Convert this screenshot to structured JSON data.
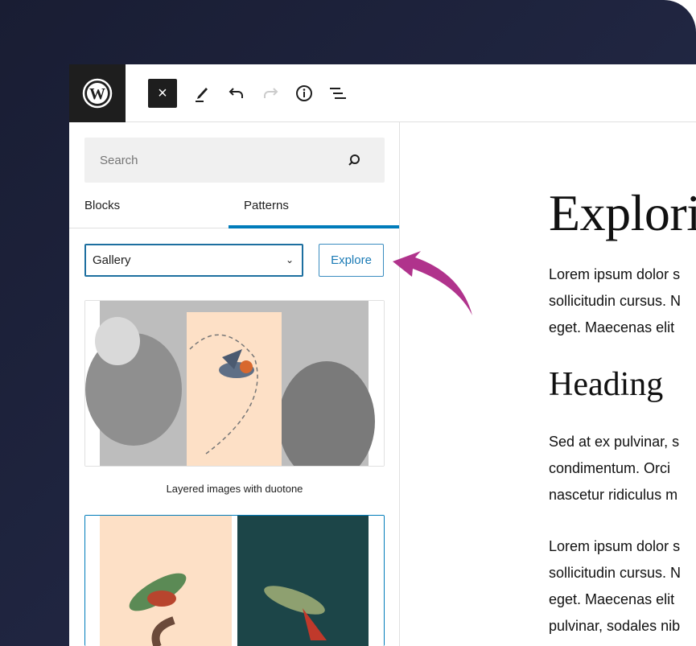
{
  "toolbar": {
    "close_label": "×"
  },
  "sidebar": {
    "search_placeholder": "Search",
    "tabs": [
      {
        "label": "Blocks"
      },
      {
        "label": "Patterns"
      }
    ],
    "category_select": "Gallery",
    "explore_label": "Explore",
    "patterns": [
      {
        "caption": "Layered images with duotone"
      },
      {
        "caption": ""
      }
    ]
  },
  "content": {
    "title": "Explori",
    "heading": "Heading",
    "paragraphs": [
      [
        "Lorem ipsum dolor s",
        "sollicitudin cursus. N",
        "eget. Maecenas elit"
      ],
      [
        "Sed at ex pulvinar, s",
        "condimentum. Orci",
        "nascetur ridiculus m"
      ],
      [
        "Lorem ipsum dolor s",
        "sollicitudin cursus. N",
        "eget. Maecenas elit",
        "pulvinar, sodales nib"
      ]
    ]
  },
  "colors": {
    "accent": "#007cba",
    "arrow": "#b0338c",
    "duotone_peach": "#fde0c6",
    "dark_teal": "#1c4548"
  }
}
